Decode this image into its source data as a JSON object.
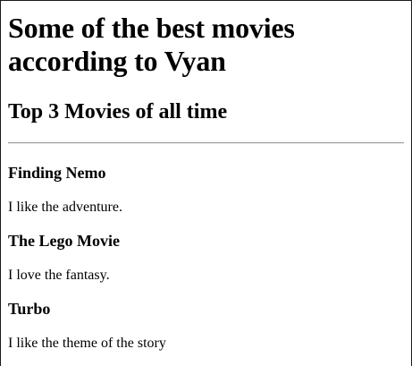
{
  "page": {
    "title": "Some of the best movies according to Vyan",
    "subtitle": "Top 3 Movies of all time"
  },
  "movies": [
    {
      "title": "Finding Nemo",
      "comment": "I like the adventure."
    },
    {
      "title": "The Lego Movie",
      "comment": "I love the fantasy."
    },
    {
      "title": "Turbo",
      "comment": "I like the theme of the story"
    }
  ]
}
